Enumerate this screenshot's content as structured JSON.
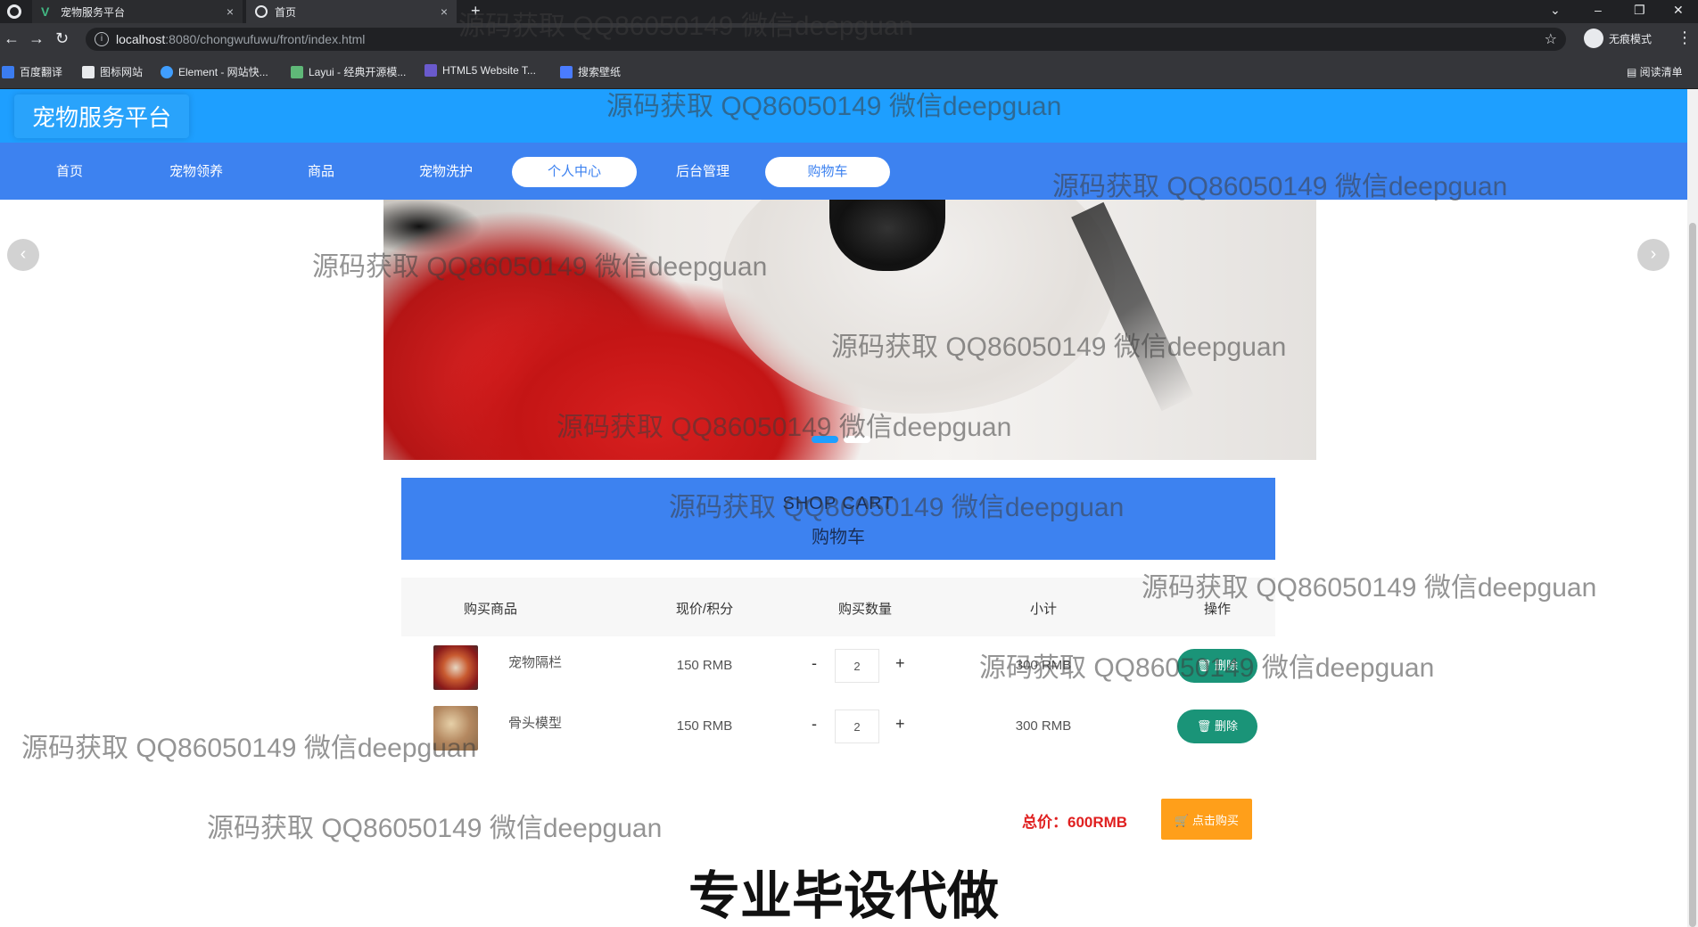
{
  "browser": {
    "tabs": [
      {
        "title": "宠物服务平台",
        "active": false
      },
      {
        "title": "首页",
        "active": true
      }
    ],
    "url_host": "localhost",
    "url_rest": ":8080/chongwufuwu/front/index.html",
    "incognito_label": "无痕模式",
    "bookmarks": [
      "百度翻译",
      "图标网站",
      "Element - 网站快...",
      "Layui - 经典开源模...",
      "HTML5 Website T...",
      "搜索壁纸"
    ],
    "reading_list": "阅读清单"
  },
  "site": {
    "title": "宠物服务平台",
    "nav": [
      {
        "label": "首页",
        "active": false
      },
      {
        "label": "宠物领养",
        "active": false
      },
      {
        "label": "商品",
        "active": false
      },
      {
        "label": "宠物洗护",
        "active": false
      },
      {
        "label": "个人中心",
        "active": true
      },
      {
        "label": "后台管理",
        "active": false
      },
      {
        "label": "购物车",
        "active": true
      }
    ]
  },
  "cart": {
    "title_en": "SHOP CART",
    "title_cn": "购物车",
    "headers": [
      "购买商品",
      "现价/积分",
      "购买数量",
      "小计",
      "操作"
    ],
    "items": [
      {
        "name": "宠物隔栏",
        "price": "150 RMB",
        "qty": "2",
        "subtotal": "300 RMB",
        "delete_label": "删除"
      },
      {
        "name": "骨头模型",
        "price": "150 RMB",
        "qty": "2",
        "subtotal": "300 RMB",
        "delete_label": "删除"
      }
    ],
    "minus": "-",
    "plus": "+",
    "total_label": "总价：600RMB",
    "buy_label": "点击购买"
  },
  "promo": "专业毕设代做",
  "watermark": "源码获取 QQ86050149 微信deepguan",
  "colors": {
    "header": "#1e9fff",
    "nav": "#3d82f0",
    "delete": "#1a9478",
    "buy": "#ff9f1a",
    "total": "#e02020"
  }
}
